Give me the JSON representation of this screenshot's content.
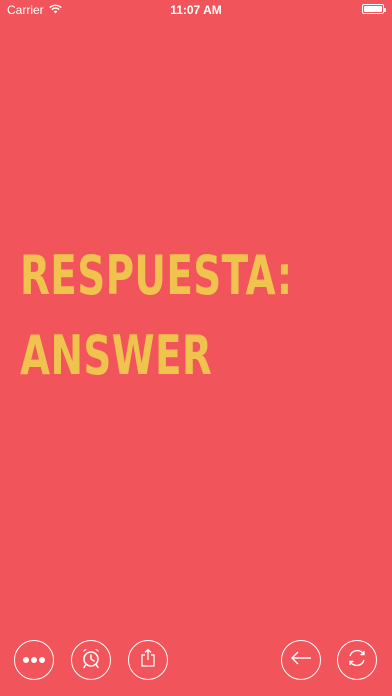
{
  "status_bar": {
    "carrier": "Carrier",
    "time": "11:07 AM"
  },
  "card": {
    "line1": "RESPUESTA:",
    "line2": "ANSWER",
    "text_color": "#f0c34e",
    "background_color": "#f2545b"
  },
  "toolbar": {
    "buttons": [
      {
        "icon": "more-icon"
      },
      {
        "icon": "alarm-clock-icon"
      },
      {
        "icon": "share-icon"
      },
      {
        "icon": "back-arrow-icon"
      },
      {
        "icon": "refresh-icon"
      }
    ]
  }
}
